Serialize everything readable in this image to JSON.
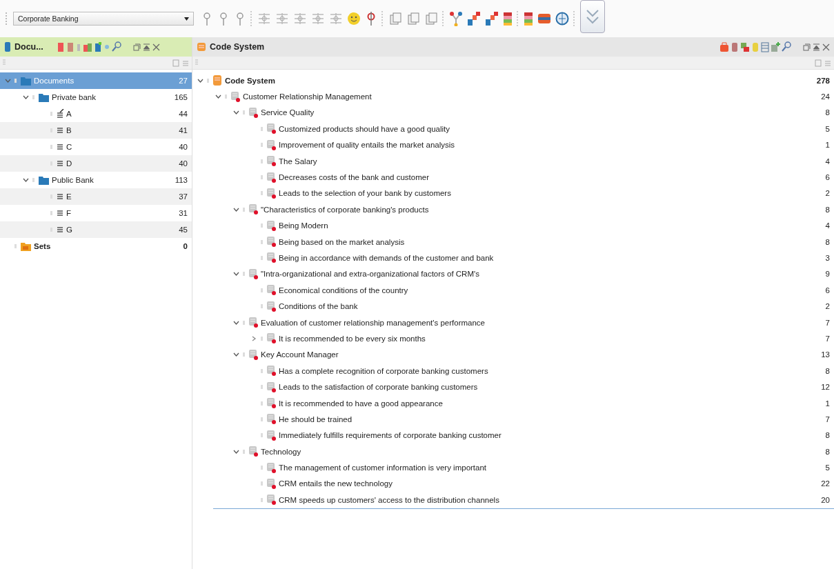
{
  "toolbar": {
    "project_dropdown": {
      "value": "Corporate Banking"
    }
  },
  "documents_panel": {
    "title": "Docu...",
    "items": [
      {
        "kind": "folder",
        "label": "Documents",
        "count": "27",
        "selected": true,
        "expanded": true,
        "children": [
          {
            "kind": "folder",
            "label": "Private bank",
            "count": "165",
            "selected": false,
            "expanded": true,
            "children": [
              {
                "kind": "memo-text",
                "label": "A",
                "count": "44",
                "selected": false
              },
              {
                "kind": "text",
                "label": "B",
                "count": "41",
                "selected": false
              },
              {
                "kind": "text",
                "label": "C",
                "count": "40",
                "selected": false
              },
              {
                "kind": "text",
                "label": "D",
                "count": "40",
                "selected": false
              }
            ]
          },
          {
            "kind": "folder",
            "label": "Public Bank",
            "count": "113",
            "selected": false,
            "expanded": true,
            "children": [
              {
                "kind": "text",
                "label": "E",
                "count": "37",
                "selected": false
              },
              {
                "kind": "text",
                "label": "F",
                "count": "31",
                "selected": false
              },
              {
                "kind": "text",
                "label": "G",
                "count": "45",
                "selected": false
              }
            ]
          }
        ]
      },
      {
        "kind": "set",
        "label": "Sets",
        "count": "0",
        "selected": false
      }
    ]
  },
  "code_panel": {
    "title": "Code System",
    "items": [
      {
        "kind": "root",
        "label": "Code System",
        "count": "278",
        "expanded": true,
        "children": [
          {
            "kind": "code",
            "label": "Customer Relationship Management",
            "count": "24",
            "expanded": true,
            "children": [
              {
                "kind": "code",
                "label": "Service Quality",
                "count": "8",
                "expanded": true,
                "children": [
                  {
                    "kind": "code",
                    "label": "Customized products should have a good quality",
                    "count": "5"
                  },
                  {
                    "kind": "code",
                    "label": "Improvement of quality entails the market analysis",
                    "count": "1"
                  },
                  {
                    "kind": "code",
                    "label": "The Salary",
                    "count": "4"
                  },
                  {
                    "kind": "code",
                    "label": "Decreases costs of the bank and customer",
                    "count": "6"
                  },
                  {
                    "kind": "code",
                    "label": "Leads to the selection of your bank by customers",
                    "count": "2"
                  }
                ]
              },
              {
                "kind": "code",
                "label": "\"Characteristics of corporate banking's products",
                "count": "8",
                "expanded": true,
                "children": [
                  {
                    "kind": "code",
                    "label": "Being Modern",
                    "count": "4"
                  },
                  {
                    "kind": "code",
                    "label": "Being based on the market analysis",
                    "count": "8"
                  },
                  {
                    "kind": "code",
                    "label": "Being in accordance with demands of the customer and bank",
                    "count": "3"
                  }
                ]
              },
              {
                "kind": "code",
                "label": "\"Intra-organizational and extra-organizational factors of CRM's",
                "count": "9",
                "expanded": true,
                "children": [
                  {
                    "kind": "code",
                    "label": "Economical conditions of the country",
                    "count": "6"
                  },
                  {
                    "kind": "code",
                    "label": "Conditions of the bank",
                    "count": "2"
                  }
                ]
              },
              {
                "kind": "code",
                "label": "Evaluation of customer relationship management's performance",
                "count": "7",
                "expanded": true,
                "children": [
                  {
                    "kind": "code",
                    "label": "It is recommended to be every six months",
                    "count": "7",
                    "expanded": false
                  }
                ]
              },
              {
                "kind": "code",
                "label": "Key Account Manager",
                "count": "13",
                "expanded": true,
                "children": [
                  {
                    "kind": "code",
                    "label": "Has a complete recognition of corporate banking customers",
                    "count": "8"
                  },
                  {
                    "kind": "code",
                    "label": "Leads to the satisfaction of corporate banking customers",
                    "count": "12"
                  },
                  {
                    "kind": "code",
                    "label": "It is recommended to have a good appearance",
                    "count": "1"
                  },
                  {
                    "kind": "code",
                    "label": "He should be trained",
                    "count": "7"
                  },
                  {
                    "kind": "code",
                    "label": "Immediately fulfills requirements of corporate banking customer",
                    "count": "8"
                  }
                ]
              },
              {
                "kind": "code",
                "label": "Technology",
                "count": "8",
                "expanded": true,
                "children": [
                  {
                    "kind": "code",
                    "label": "The management of customer information is very important",
                    "count": "5"
                  },
                  {
                    "kind": "code",
                    "label": "CRM entails the new technology",
                    "count": "22"
                  },
                  {
                    "kind": "code",
                    "label": "CRM speeds up customers' access to the distribution channels",
                    "count": "20"
                  }
                ]
              }
            ]
          }
        ]
      }
    ]
  }
}
